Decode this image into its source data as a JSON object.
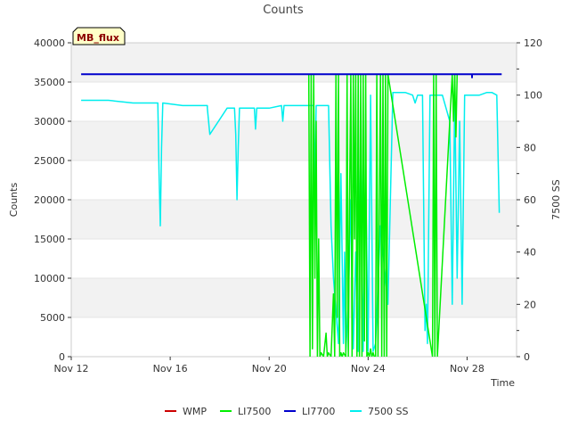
{
  "chart_data": {
    "type": "line",
    "title": "Counts",
    "xlabel": "Time",
    "ylabel": "Counts",
    "y2label": "7500 SS",
    "annotation": "MB_flux",
    "x_ticks": [
      "Nov 12",
      "Nov 16",
      "Nov 20",
      "Nov 24",
      "Nov 28"
    ],
    "x_tick_days": [
      0,
      4,
      8,
      12,
      16
    ],
    "x_range_days": [
      0,
      18
    ],
    "ylim": [
      0,
      40000
    ],
    "y_ticks": [
      0,
      5000,
      10000,
      15000,
      20000,
      25000,
      30000,
      35000,
      40000
    ],
    "y2lim": [
      0,
      120
    ],
    "y2_ticks": [
      0,
      20,
      40,
      60,
      80,
      100,
      120
    ],
    "grid_bands": true,
    "legend_position": "bottom",
    "legend": [
      "WMP",
      "LI7500",
      "LI7700",
      "7500 SS"
    ],
    "colors": {
      "WMP": "#cc0000",
      "LI7500": "#00ee00",
      "LI7700": "#0000cc",
      "7500 SS": "#00eeee"
    },
    "series": [
      {
        "name": "LI7700",
        "axis": "left",
        "x_days": [
          0.4,
          17.4
        ],
        "values": [
          36000,
          36000
        ],
        "dips": [
          {
            "x_day": 16.2,
            "value": 35500
          }
        ]
      },
      {
        "name": "7500 SS",
        "axis": "right",
        "x_days": [
          0.4,
          1.5,
          2.5,
          3.5,
          3.55,
          3.6,
          3.65,
          3.7,
          4.5,
          5.5,
          5.5,
          5.6,
          6.3,
          6.6,
          6.65,
          6.7,
          6.75,
          6.8,
          7.4,
          7.45,
          7.5,
          8.0,
          8.5,
          8.55,
          8.6,
          9.5,
          9.8,
          9.85,
          9.9,
          10.4,
          10.5,
          10.6,
          10.8,
          10.9,
          11.0,
          11.05,
          11.1,
          11.2,
          11.3,
          11.4,
          11.5,
          11.6,
          11.7,
          11.8,
          11.9,
          12.0,
          12.1,
          12.2,
          12.3,
          12.5,
          12.8,
          13.0,
          13.5,
          13.8,
          13.9,
          14.0,
          14.1,
          14.2,
          14.3,
          14.35,
          14.4,
          14.5,
          14.6,
          14.7,
          15.0,
          15.3,
          15.4,
          15.5,
          15.6,
          15.7,
          15.8,
          15.9,
          16.0,
          16.5,
          16.8,
          17.0,
          17.2,
          17.3
        ],
        "values": [
          98,
          98,
          97,
          97,
          70,
          50,
          80,
          97,
          96,
          96,
          95,
          85,
          95,
          95,
          85,
          60,
          80,
          95,
          95,
          87,
          95,
          95,
          96,
          90,
          96,
          96,
          96,
          65,
          96,
          96,
          50,
          30,
          5,
          70,
          5,
          40,
          2,
          20,
          60,
          3,
          40,
          2,
          80,
          2,
          70,
          2,
          100,
          2,
          5,
          50,
          20,
          101,
          101,
          100,
          97,
          100,
          100,
          100,
          10,
          20,
          5,
          100,
          100,
          100,
          100,
          90,
          20,
          100,
          30,
          90,
          20,
          100,
          100,
          100,
          101,
          101,
          100,
          55
        ]
      },
      {
        "name": "LI7500",
        "axis": "left",
        "x_days": [
          9.6,
          9.65,
          9.7,
          9.75,
          9.8,
          9.85,
          9.9,
          9.95,
          10.0,
          10.05,
          10.1,
          10.2,
          10.3,
          10.35,
          10.4,
          10.5,
          10.6,
          10.65,
          10.7,
          10.75,
          10.8,
          10.85,
          10.9,
          10.95,
          11.0,
          11.1,
          11.15,
          11.2,
          11.25,
          11.3,
          11.35,
          11.4,
          11.45,
          11.5,
          11.55,
          11.6,
          11.65,
          11.7,
          11.75,
          11.8,
          11.85,
          11.9,
          11.95,
          12.0,
          12.05,
          12.1,
          12.15,
          12.2,
          12.25,
          12.3,
          12.35,
          12.4,
          12.5,
          12.55,
          12.6,
          12.65,
          12.7,
          12.75,
          12.8,
          14.6,
          14.65,
          14.7,
          14.75,
          14.8,
          15.4,
          15.45,
          15.5,
          15.55,
          15.6
        ],
        "values": [
          36000,
          0,
          36000,
          1000,
          36000,
          10000,
          30000,
          0,
          15000,
          0,
          500,
          0,
          3000,
          0,
          500,
          0,
          8000,
          0,
          36000,
          5000,
          36000,
          0,
          500,
          0,
          500,
          0,
          36000,
          0,
          20000,
          36000,
          0,
          36000,
          15000,
          36000,
          0,
          36000,
          0,
          36000,
          0,
          36000,
          2000,
          36000,
          0,
          500,
          0,
          1000,
          0,
          500,
          0,
          0,
          36000,
          0,
          36000,
          0,
          36000,
          0,
          36000,
          0,
          36000,
          0,
          36000,
          0,
          36000,
          0,
          36000,
          30000,
          36000,
          28000,
          36000
        ]
      }
    ]
  }
}
